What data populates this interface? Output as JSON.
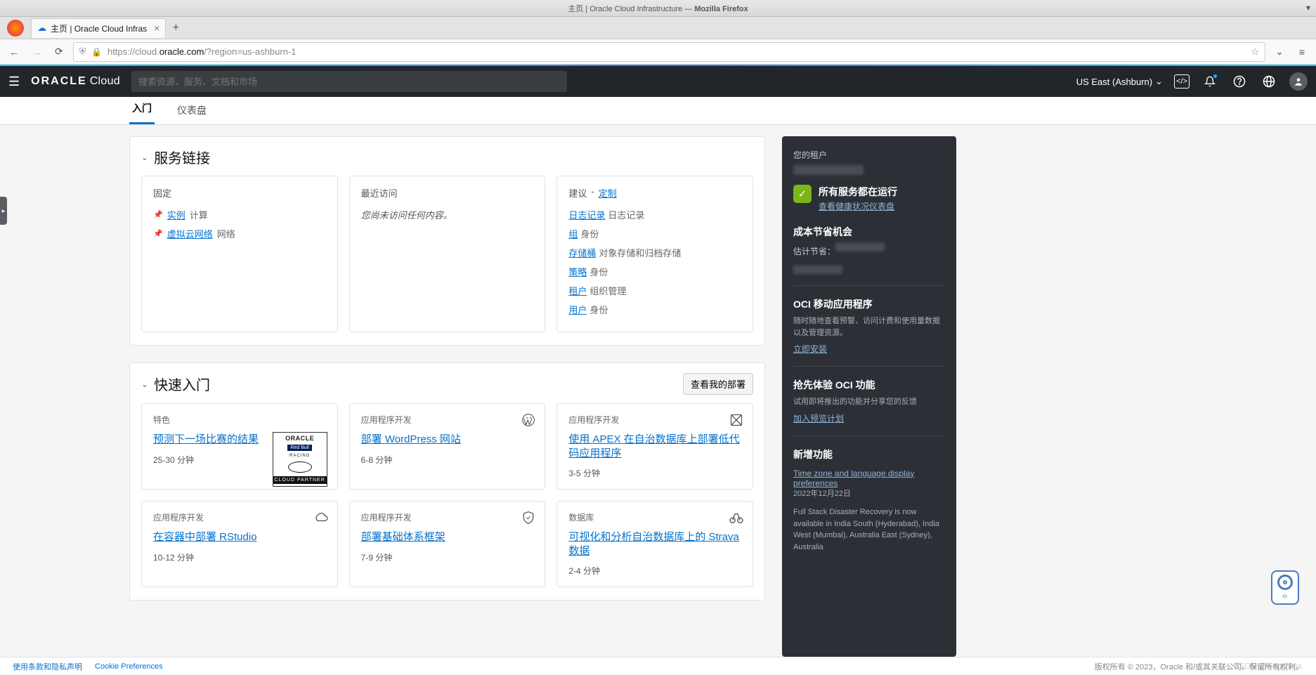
{
  "window": {
    "title_prefix": "主页 | Oracle Cloud Infrastructure — ",
    "title_suffix": "Mozilla Firefox"
  },
  "browser_tab": {
    "label": "主页 | Oracle Cloud Infras"
  },
  "url": {
    "protocol": "https://",
    "sub": "cloud.",
    "domain": "oracle.com",
    "path": "/?region=us-ashburn-1"
  },
  "header": {
    "logo1": "ORACLE",
    "logo2": "Cloud",
    "search_placeholder": "搜索资源、服务、文档和市场",
    "region": "US East (Ashburn)"
  },
  "tabs": {
    "active": "入门",
    "inactive": "仪表盘"
  },
  "svc_section": {
    "title": "服务链接",
    "pinned": {
      "title": "固定",
      "items": [
        {
          "link": "实例",
          "desc": "计算"
        },
        {
          "link": "虚拟云网络",
          "desc": "网络"
        }
      ]
    },
    "recent": {
      "title": "最近访问",
      "empty": "您尚未访问任何内容。"
    },
    "advice": {
      "title": "建议",
      "customize": "定制",
      "items": [
        {
          "link": "日志记录",
          "desc": "日志记录"
        },
        {
          "link": "组",
          "desc": "身份"
        },
        {
          "link": "存储桶",
          "desc": "对象存储和归档存储"
        },
        {
          "link": "策略",
          "desc": "身份"
        },
        {
          "link": "租户",
          "desc": "组织管理"
        },
        {
          "link": "用户",
          "desc": "身份"
        }
      ]
    }
  },
  "quick_section": {
    "title": "快速入门",
    "view_btn": "查看我的部署",
    "tiles": [
      {
        "cat": "特色",
        "title": "预测下一场比赛的结果",
        "time": "25-30 分钟",
        "icon": "redbull"
      },
      {
        "cat": "应用程序开发",
        "title": "部署 WordPress 网站",
        "time": "6-8 分钟",
        "icon": "wordpress"
      },
      {
        "cat": "应用程序开发",
        "title": "使用 APEX 在自治数据库上部署低代码应用程序",
        "time": "3-5 分钟",
        "icon": "apex"
      },
      {
        "cat": "应用程序开发",
        "title": "在容器中部署 RStudio",
        "time": "10-12 分钟",
        "icon": "cloud"
      },
      {
        "cat": "应用程序开发",
        "title": "部署基础体系框架",
        "time": "7-9 分钟",
        "icon": "shield"
      },
      {
        "cat": "数据库",
        "title": "可视化和分析自治数据库上的 Strava 数据",
        "time": "2-4 分钟",
        "icon": "bike"
      }
    ]
  },
  "right": {
    "tenant_label": "您的租户",
    "status": {
      "title": "所有服务都在运行",
      "sub": "查看健康状况仪表盘"
    },
    "cost": {
      "title": "成本节省机会",
      "est": "估计节省："
    },
    "mobile": {
      "title": "OCI 移动应用程序",
      "desc": "随时随地查看预警、访问计费和使用量数据以及管理资源。",
      "link": "立即安装"
    },
    "preview": {
      "title": "抢先体验 OCI 功能",
      "desc": "试用即将推出的功能并分享您的反馈",
      "link": "加入预览计划"
    },
    "news": {
      "title": "新增功能",
      "item_title": "Time zone and language display preferences",
      "item_date": "2022年12月22日",
      "body": "Full Stack Disaster Recovery is now available in India South (Hyderabad), India West (Mumbai), Australia East (Sydney), Australia"
    }
  },
  "footer": {
    "terms": "使用条款和隐私声明",
    "cookie": "Cookie Preferences",
    "copyright": "版权所有 © 2023，Oracle 和/或其关联公司。保留所有权利。"
  },
  "help_dots": "፨",
  "redbull": {
    "top": "ORACLE",
    "mid": "Red Bull",
    "mid2": "RACING",
    "bot": "CLOUD PARTNER"
  }
}
